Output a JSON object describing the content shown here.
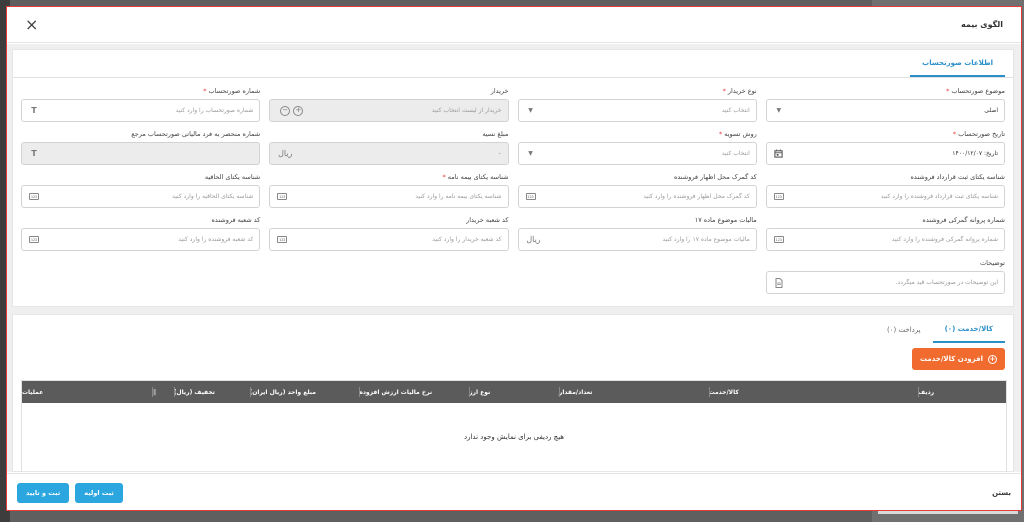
{
  "modal": {
    "title": "الگوی بیمه"
  },
  "tabs": [
    {
      "label": "اطلاعات صورتحساب"
    }
  ],
  "form": {
    "fields": [
      {
        "label": "موضوع صورتحساب",
        "required": true,
        "value": "اصلی",
        "placeholder": "",
        "icon": "chevron-down"
      },
      {
        "label": "نوع خریدار",
        "required": true,
        "value": "",
        "placeholder": "انتخاب کنید",
        "icon": "chevron-down"
      },
      {
        "label": "خریدار",
        "required": false,
        "value": "",
        "placeholder": "خریدار از لیست انتخاب کنید",
        "icon": "add-remove",
        "disabled": true
      },
      {
        "label": "شماره صورتحساب",
        "required": true,
        "value": "",
        "placeholder": "شماره صورتحساب را وارد کنید",
        "icon": "text-t"
      },
      {
        "label": "تاریخ صورتحساب",
        "required": true,
        "value": "تاریخ: ۱۴۰۰/۱۲/۰۷",
        "placeholder": "",
        "icon": "calendar"
      },
      {
        "label": "روش تسویه",
        "required": true,
        "value": "",
        "placeholder": "انتخاب کنید",
        "icon": "chevron-down"
      },
      {
        "label": "مبلغ نسیه",
        "required": false,
        "value": "۰",
        "placeholder": "",
        "icon": "rial",
        "disabled": true
      },
      {
        "label": "شماره منحصر به فرد مالیاتی صورتحساب مرجع",
        "required": false,
        "value": "",
        "placeholder": "",
        "icon": "text-t",
        "disabled": true
      },
      {
        "label": "شناسه یکتای ثبت قرارداد فروشنده",
        "required": false,
        "value": "",
        "placeholder": "شناسه یکتای ثبت قرارداد فروشنده را وارد کنید",
        "icon": "number-123"
      },
      {
        "label": "کد گمرک محل اظهار فروشنده",
        "required": false,
        "value": "",
        "placeholder": "کد گمرک محل اظهار فروشنده را وارد کنید",
        "icon": "number-123"
      },
      {
        "label": "شناسه یکتای بیمه نامه",
        "required": true,
        "value": "",
        "placeholder": "شناسه یکتای بیمه نامه را وارد کنید",
        "icon": "number-123"
      },
      {
        "label": "شناسه یکتای الحاقیه",
        "required": false,
        "value": "",
        "placeholder": "شناسه یکتای الحاقیه را وارد کنید",
        "icon": "number-123"
      },
      {
        "label": "شماره پروانه گمرکی فروشنده",
        "required": false,
        "value": "",
        "placeholder": "شماره پروانه گمرکی فروشنده را وارد کنید",
        "icon": "number-123"
      },
      {
        "label": "مالیات موضوع ماده ۱۷",
        "required": false,
        "value": "",
        "placeholder": "مالیات موضوع ماده ۱۷ را وارد کنید",
        "icon": "rial"
      },
      {
        "label": "کد شعبه خریدار",
        "required": false,
        "value": "",
        "placeholder": "کد شعبه خریدار را وارد کنید",
        "icon": "number-123"
      },
      {
        "label": "کد شعبه فروشنده",
        "required": false,
        "value": "",
        "placeholder": "کد شعبه فروشنده را وارد کنید",
        "icon": "number-123"
      },
      {
        "label": "توضیحات",
        "required": false,
        "value": "",
        "placeholder": "این توضیحات در صورتحساب قید میگردد.",
        "icon": "document"
      }
    ],
    "rial_symbol": "ریال",
    "t_symbol": "T",
    "num_symbol": "123"
  },
  "items": {
    "tabs": [
      {
        "label": "کالا/خدمت (۰)"
      },
      {
        "label": "پرداخت (۰)"
      }
    ],
    "add_button": "افزودن کالا/خدمت",
    "columns": [
      "ردیف",
      "کالا/خدمت",
      "تعداد/مقدار",
      "نوع ارز",
      "نرخ مالیات ارزش افزوده",
      "مبلغ واحد (ریال ایران)",
      "تخفیف (ریال)",
      "||",
      "عملیات"
    ],
    "empty_message": "هیچ ردیفی برای نمایش وجود ندارد"
  },
  "footer": {
    "close_label": "بستن",
    "save_draft_label": "ثبت اولیه",
    "save_confirm_label": "ثبت و تایید"
  },
  "colors": {
    "accent": "#2ba6de",
    "orange": "#f06b2d",
    "required": "#e23b3b",
    "table_head": "#5b5b5b",
    "modal_border": "#e23b3b"
  }
}
